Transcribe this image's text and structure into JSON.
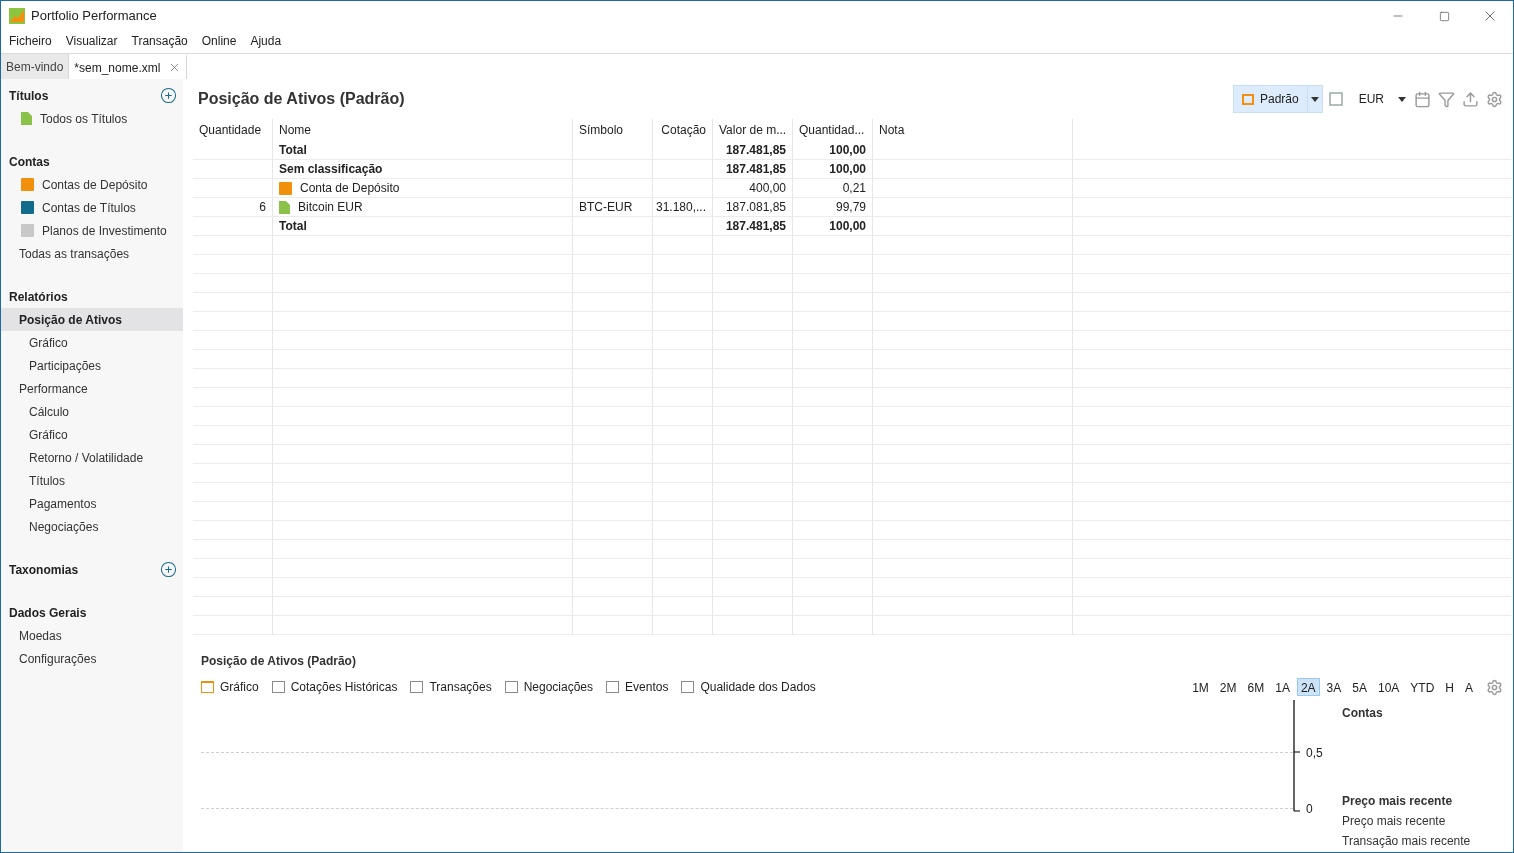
{
  "window": {
    "title": "Portfolio Performance"
  },
  "menu": [
    "Ficheiro",
    "Visualizar",
    "Transação",
    "Online",
    "Ajuda"
  ],
  "tabs": [
    {
      "label": "Bem-vindo",
      "selected": false,
      "closable": false
    },
    {
      "label": "*sem_nome.xml",
      "selected": true,
      "closable": true
    }
  ],
  "sidebar": {
    "sections": [
      {
        "title": "Títulos",
        "add_button": true,
        "items": [
          {
            "label": "Todos os Títulos",
            "kind": "security",
            "selected": false
          }
        ]
      },
      {
        "title": "Contas",
        "add_button": false,
        "items": [
          {
            "label": "Contas de Depósito",
            "kind": "deposit",
            "selected": false
          },
          {
            "label": "Contas de Títulos",
            "kind": "securities",
            "selected": false
          },
          {
            "label": "Planos de Investimento",
            "kind": "plan",
            "selected": false
          },
          {
            "label": "Todas as transações",
            "selected": false
          }
        ]
      },
      {
        "title": "Relatórios",
        "add_button": false,
        "items": [
          {
            "label": "Posição de Ativos",
            "selected": true,
            "children": [
              {
                "label": "Gráfico",
                "selected": false
              },
              {
                "label": "Participações",
                "selected": false
              }
            ]
          },
          {
            "label": "Performance",
            "selected": false,
            "children": [
              {
                "label": "Cálculo",
                "selected": false
              },
              {
                "label": "Gráfico",
                "selected": false
              },
              {
                "label": "Retorno / Volatilidade",
                "selected": false
              },
              {
                "label": "Títulos",
                "selected": false
              },
              {
                "label": "Pagamentos",
                "selected": false
              },
              {
                "label": "Negociações",
                "selected": false
              }
            ]
          }
        ]
      },
      {
        "title": "Taxonomias",
        "add_button": true
      },
      {
        "title": "Dados Gerais",
        "add_button": false,
        "items": [
          {
            "label": "Moedas",
            "selected": false
          },
          {
            "label": "Configurações",
            "selected": false
          }
        ]
      }
    ]
  },
  "view": {
    "title": "Posição de Ativos (Padrão)",
    "view_button": "Padrão",
    "currency": "EUR"
  },
  "table": {
    "columns": [
      "Quantidade",
      "Nome",
      "Símbolo",
      "Cotação",
      "Valor de m...",
      "Quantidad...",
      "Nota"
    ],
    "rows": [
      {
        "kind": "total",
        "cells": [
          "",
          "Total",
          "",
          "",
          "187.481,85",
          "100,00",
          ""
        ]
      },
      {
        "kind": "group",
        "cells": [
          "",
          "Sem classificação",
          "",
          "",
          "187.481,85",
          "100,00",
          ""
        ]
      },
      {
        "kind": "deposit",
        "cells": [
          "",
          "Conta de Depósito",
          "",
          "",
          "400,00",
          "0,21",
          ""
        ]
      },
      {
        "kind": "security",
        "cells": [
          "6",
          "Bitcoin EUR",
          "BTC-EUR",
          "31.180,...",
          "187.081,85",
          "99,79",
          ""
        ]
      },
      {
        "kind": "total",
        "cells": [
          "",
          "Total",
          "",
          "",
          "187.481,85",
          "100,00",
          ""
        ]
      }
    ]
  },
  "bottom": {
    "title": "Posição de Ativos (Padrão)",
    "panes": [
      {
        "label": "Gráfico",
        "selected": true
      },
      {
        "label": "Cotações Históricas",
        "selected": false
      },
      {
        "label": "Transações",
        "selected": false
      },
      {
        "label": "Negociações",
        "selected": false
      },
      {
        "label": "Eventos",
        "selected": false
      },
      {
        "label": "Qualidade dos Dados",
        "selected": false
      }
    ],
    "periods": [
      {
        "label": "1M",
        "selected": false
      },
      {
        "label": "2M",
        "selected": false
      },
      {
        "label": "6M",
        "selected": false
      },
      {
        "label": "1A",
        "selected": false
      },
      {
        "label": "2A",
        "selected": true
      },
      {
        "label": "3A",
        "selected": false
      },
      {
        "label": "5A",
        "selected": false
      },
      {
        "label": "10A",
        "selected": false
      },
      {
        "label": "YTD",
        "selected": false
      },
      {
        "label": "H",
        "selected": false
      },
      {
        "label": "A",
        "selected": false
      }
    ],
    "axis_labels": [
      "0,5",
      "0"
    ],
    "legend": [
      {
        "label": "Contas",
        "bold": true
      },
      {
        "label": "Preço mais recente",
        "bold": true
      },
      {
        "label": "Preço mais recente",
        "bold": false
      },
      {
        "label": "Transação mais recente",
        "bold": false
      }
    ]
  }
}
